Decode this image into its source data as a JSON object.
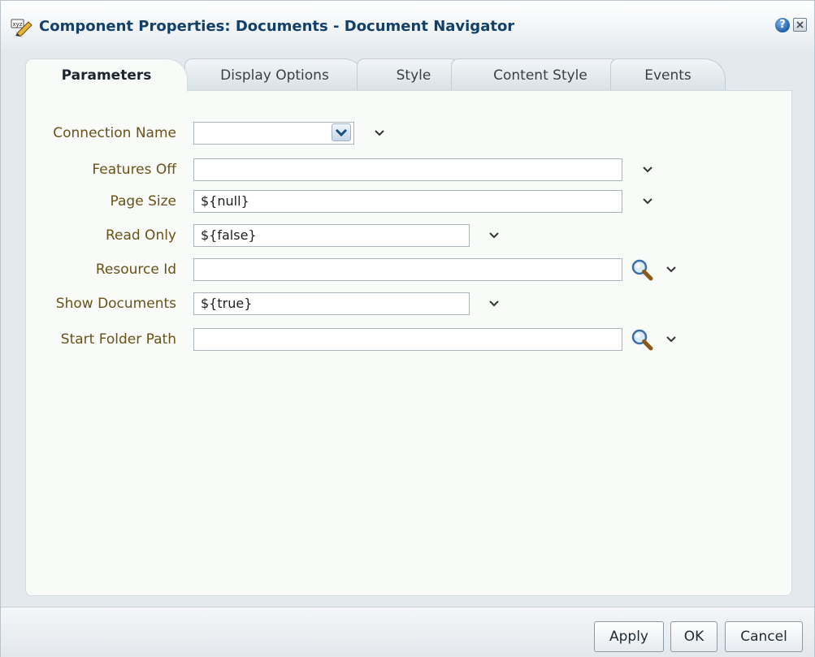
{
  "dialog": {
    "title": "Component Properties: Documents - Document Navigator",
    "icons": {
      "title": "component-properties-icon",
      "help": "help-icon",
      "close": "close-icon"
    }
  },
  "tabs": [
    {
      "label": "Parameters",
      "active": true
    },
    {
      "label": "Display Options",
      "active": false
    },
    {
      "label": "Style",
      "active": false
    },
    {
      "label": "Content Style",
      "active": false
    },
    {
      "label": "Events",
      "active": false
    }
  ],
  "parameters": [
    {
      "label": "Connection Name",
      "value": "",
      "type": "select"
    },
    {
      "label": "Features Off",
      "value": "",
      "type": "text"
    },
    {
      "label": "Page Size",
      "value": "${null}",
      "type": "text"
    },
    {
      "label": "Read Only",
      "value": "${false}",
      "type": "text"
    },
    {
      "label": "Resource Id",
      "value": "",
      "type": "text-search"
    },
    {
      "label": "Show Documents",
      "value": "${true}",
      "type": "text"
    },
    {
      "label": "Start Folder Path",
      "value": "",
      "type": "text-search"
    }
  ],
  "footer": {
    "apply_label": "Apply",
    "ok_label": "OK",
    "cancel_label": "Cancel"
  },
  "colors": {
    "title_text": "#12406a",
    "label_text": "#6b5117",
    "panel_bg": "#f8fbf8",
    "dialog_bg": "#e4e9ee"
  },
  "help_glyph": "?"
}
